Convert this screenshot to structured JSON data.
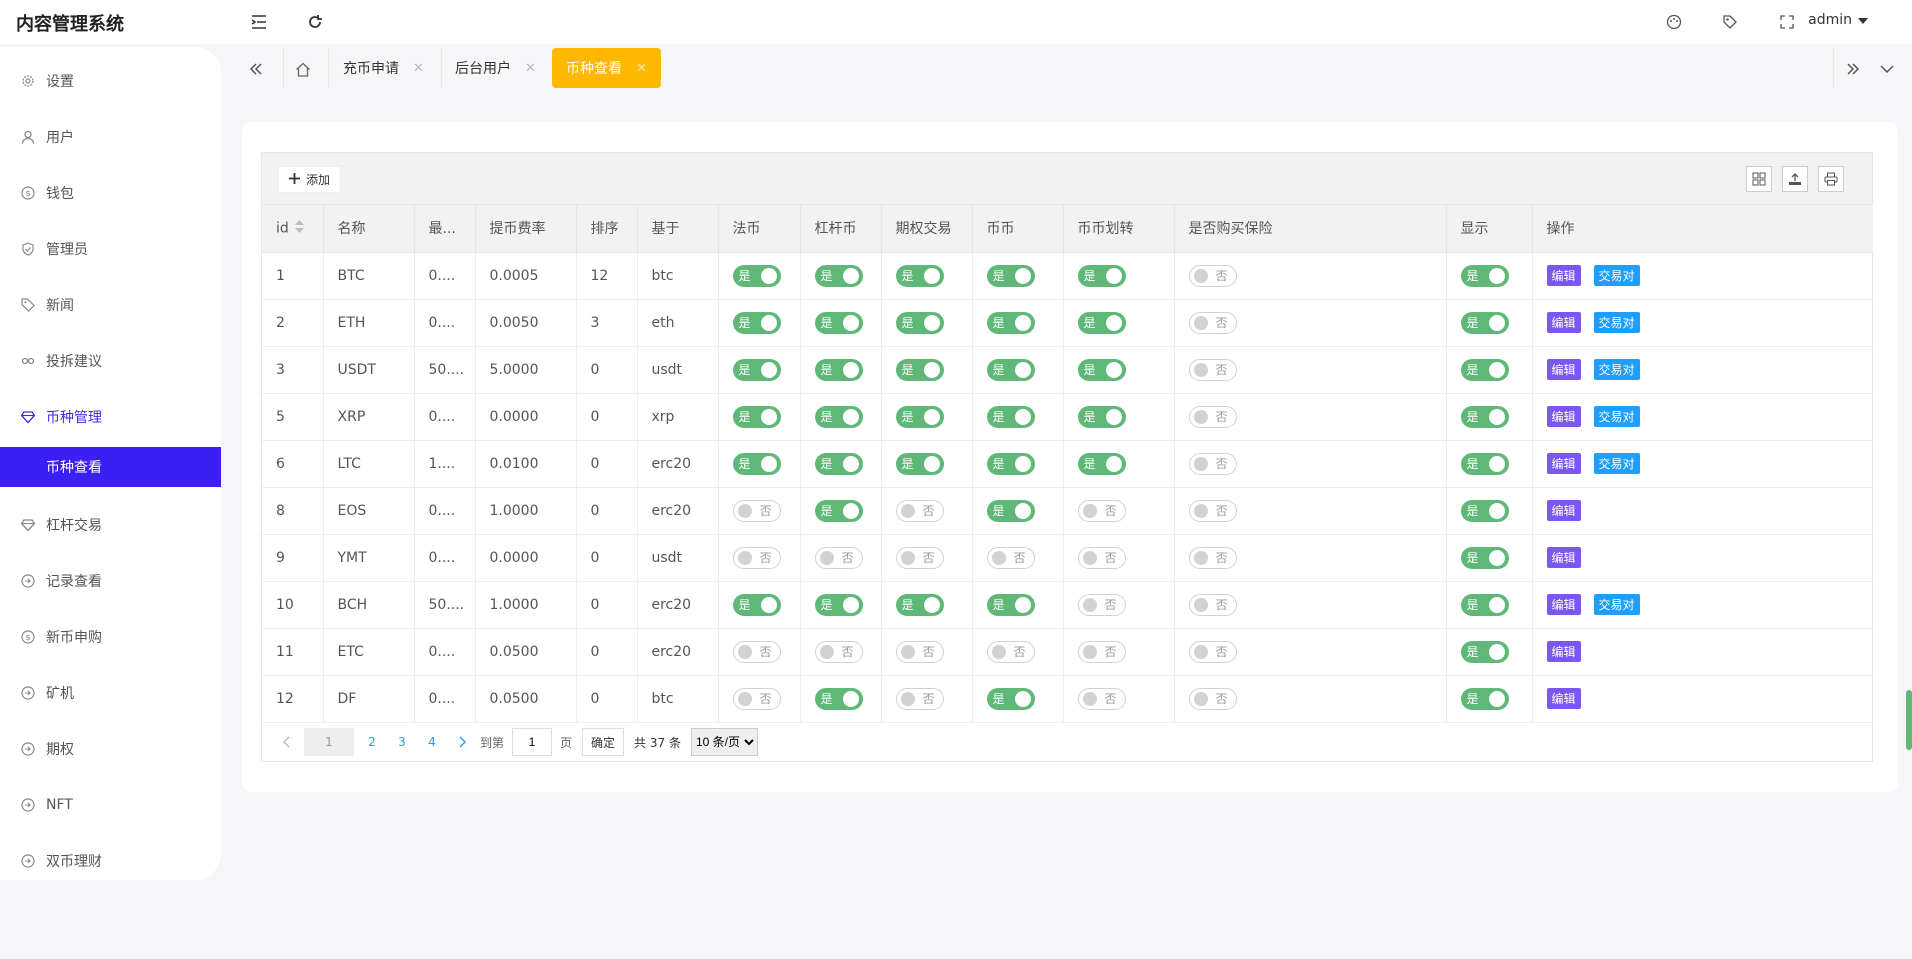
{
  "app": {
    "title": "内容管理系统",
    "user": "admin"
  },
  "sidebar": {
    "items": [
      {
        "label": "设置"
      },
      {
        "label": "用户"
      },
      {
        "label": "钱包"
      },
      {
        "label": "管理员"
      },
      {
        "label": "新闻"
      },
      {
        "label": "投拆建议"
      },
      {
        "label": "币种管理"
      },
      {
        "label": "杠杆交易"
      },
      {
        "label": "记录查看"
      },
      {
        "label": "新币申购"
      },
      {
        "label": "矿机"
      },
      {
        "label": "期权"
      },
      {
        "label": "NFT"
      },
      {
        "label": "双币理财"
      }
    ],
    "active_sub": "币种查看"
  },
  "tabs": [
    {
      "label": "充币申请"
    },
    {
      "label": "后台用户"
    },
    {
      "label": "币种查看"
    }
  ],
  "toolbar": {
    "add_label": "添加"
  },
  "columns": [
    "id",
    "名称",
    "最...",
    "提币费率",
    "排序",
    "基于",
    "法币",
    "杠杆币",
    "期权交易",
    "币币",
    "币币划转",
    "是否购买保险",
    "显示",
    "操作"
  ],
  "switch_labels": {
    "on": "是",
    "off": "否"
  },
  "action_labels": {
    "edit": "编辑",
    "pair": "交易对"
  },
  "rows": [
    {
      "id": "1",
      "name": "BTC",
      "min": "0....",
      "fee": "0.0005",
      "sort": "12",
      "base": "btc",
      "fiat": true,
      "lever": true,
      "option": true,
      "coin": true,
      "transfer": true,
      "insurance": false,
      "show": true,
      "pair": true
    },
    {
      "id": "2",
      "name": "ETH",
      "min": "0....",
      "fee": "0.0050",
      "sort": "3",
      "base": "eth",
      "fiat": true,
      "lever": true,
      "option": true,
      "coin": true,
      "transfer": true,
      "insurance": false,
      "show": true,
      "pair": true
    },
    {
      "id": "3",
      "name": "USDT",
      "min": "50....",
      "fee": "5.0000",
      "sort": "0",
      "base": "usdt",
      "fiat": true,
      "lever": true,
      "option": true,
      "coin": true,
      "transfer": true,
      "insurance": false,
      "show": true,
      "pair": true
    },
    {
      "id": "5",
      "name": "XRP",
      "min": "0....",
      "fee": "0.0000",
      "sort": "0",
      "base": "xrp",
      "fiat": true,
      "lever": true,
      "option": true,
      "coin": true,
      "transfer": true,
      "insurance": false,
      "show": true,
      "pair": true
    },
    {
      "id": "6",
      "name": "LTC",
      "min": "1....",
      "fee": "0.0100",
      "sort": "0",
      "base": "erc20",
      "fiat": true,
      "lever": true,
      "option": true,
      "coin": true,
      "transfer": true,
      "insurance": false,
      "show": true,
      "pair": true
    },
    {
      "id": "8",
      "name": "EOS",
      "min": "0....",
      "fee": "1.0000",
      "sort": "0",
      "base": "erc20",
      "fiat": false,
      "lever": true,
      "option": false,
      "coin": true,
      "transfer": false,
      "insurance": false,
      "show": true,
      "pair": false
    },
    {
      "id": "9",
      "name": "YMT",
      "min": "0....",
      "fee": "0.0000",
      "sort": "0",
      "base": "usdt",
      "fiat": false,
      "lever": false,
      "option": false,
      "coin": false,
      "transfer": false,
      "insurance": false,
      "show": true,
      "pair": false
    },
    {
      "id": "10",
      "name": "BCH",
      "min": "50....",
      "fee": "1.0000",
      "sort": "0",
      "base": "erc20",
      "fiat": true,
      "lever": true,
      "option": true,
      "coin": true,
      "transfer": false,
      "insurance": false,
      "show": true,
      "pair": true
    },
    {
      "id": "11",
      "name": "ETC",
      "min": "0....",
      "fee": "0.0500",
      "sort": "0",
      "base": "erc20",
      "fiat": false,
      "lever": false,
      "option": false,
      "coin": false,
      "transfer": false,
      "insurance": false,
      "show": true,
      "pair": false
    },
    {
      "id": "12",
      "name": "DF",
      "min": "0....",
      "fee": "0.0500",
      "sort": "0",
      "base": "btc",
      "fiat": false,
      "lever": true,
      "option": false,
      "coin": true,
      "transfer": false,
      "insurance": false,
      "show": true,
      "pair": false
    }
  ],
  "pager": {
    "current": "1",
    "pages": [
      "2",
      "3",
      "4"
    ],
    "goto_label": "到第",
    "goto_value": "1",
    "page_unit": "页",
    "confirm": "确定",
    "total": "共 37 条",
    "page_size": "10 条/页"
  },
  "colors": {
    "accent": "#3b1ff5",
    "tab_active": "#ffb800",
    "switch_on": "#5fb878",
    "edit": "#7b56f2",
    "pair": "#1e9fff"
  },
  "icons": [
    "menu-fold-icon",
    "refresh-icon",
    "theme-icon",
    "tag-icon",
    "fullscreen-icon",
    "chevron-down-icon",
    "double-left-icon",
    "home-icon",
    "double-right-icon",
    "grid-icon",
    "export-icon",
    "print-icon"
  ]
}
